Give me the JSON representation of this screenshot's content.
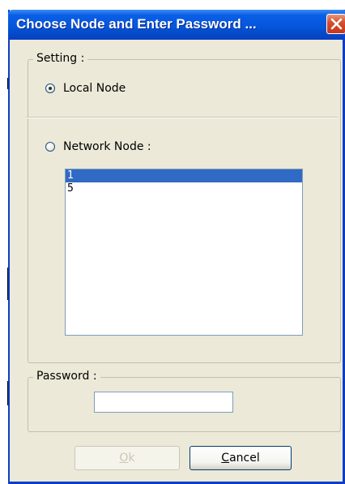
{
  "window": {
    "title": "Choose Node and Enter Password ..."
  },
  "setting": {
    "label": "Setting :",
    "local_node": {
      "label": "Local Node",
      "checked": true
    },
    "network_node": {
      "label": "Network Node :",
      "checked": false
    },
    "nodes": [
      {
        "label": "1",
        "selected": true
      },
      {
        "label": "5",
        "selected": false
      }
    ]
  },
  "password": {
    "label": "Password :",
    "value": ""
  },
  "buttons": {
    "ok": {
      "first": "O",
      "rest": "k",
      "enabled": false
    },
    "cancel": {
      "first": "C",
      "rest": "ancel",
      "enabled": true
    }
  },
  "colors": {
    "titlebar": "#0556dc",
    "dialog_bg": "#ece9d8",
    "selection": "#316ac5",
    "close_button": "#c8361a"
  },
  "icons": {
    "close": "close-x-icon",
    "radio": "radio-icon"
  }
}
